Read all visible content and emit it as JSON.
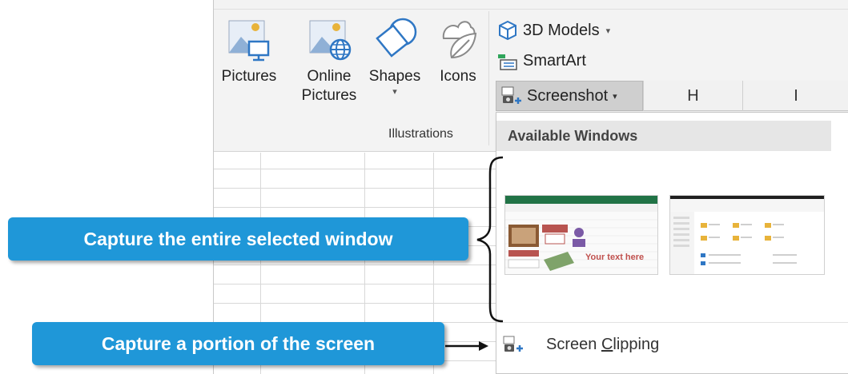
{
  "ribbon": {
    "buttons": {
      "pictures": "Pictures",
      "online_pictures": [
        "Online",
        "Pictures"
      ],
      "shapes": "Shapes",
      "icons": "Icons"
    },
    "small_buttons": {
      "models": "3D Models",
      "smartart": "SmartArt",
      "screenshot": "Screenshot"
    },
    "group_label": "Illustrations"
  },
  "column_headers": [
    "H",
    "I"
  ],
  "dropdown": {
    "header": "Available Windows",
    "windows": [
      {
        "icon": "excel-window-thumbnail",
        "overlay_text": "Your text here"
      },
      {
        "icon": "file-explorer-window-thumbnail"
      }
    ],
    "clip_label_pre": "Screen ",
    "clip_label_mnemonic": "C",
    "clip_label_post": "lipping"
  },
  "callouts": {
    "entire_window": "Capture the entire selected window",
    "portion": "Capture a portion of the screen"
  },
  "colors": {
    "callout": "#1f97d8",
    "icon_blue": "#2f77c4",
    "ribbon_bg": "#f3f3f3",
    "selected_button": "#cfcfcf"
  }
}
